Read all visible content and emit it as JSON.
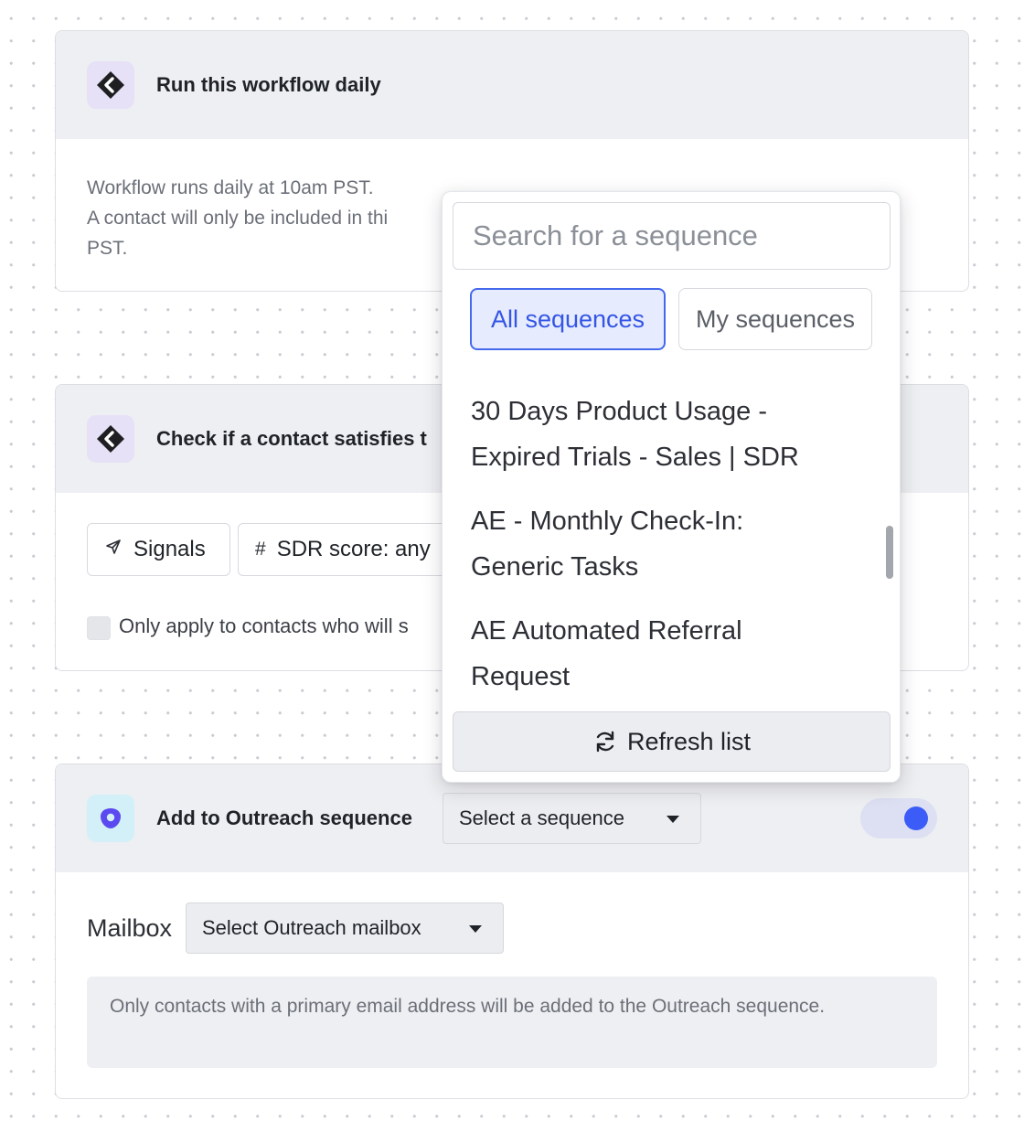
{
  "workflow_step": {
    "title": "Run this workflow daily",
    "description_line1": "Workflow runs daily at 10am PST.",
    "description_line2_visible": "A contact will only be included in thi",
    "description_line3": "PST."
  },
  "condition_step": {
    "title_visible": "Check if a contact satisfies t",
    "signals_label": "Signals",
    "sdr_score_label_visible": "SDR score: any",
    "checkbox_label_visible": "Only apply to contacts who will s",
    "checkbox_checked": false
  },
  "outreach_step": {
    "title": "Add to Outreach sequence",
    "sequence_select_label": "Select a sequence",
    "toggle_on": true,
    "mailbox_label": "Mailbox",
    "mailbox_select_label": "Select Outreach mailbox",
    "note": "Only contacts with a primary email address will be added to the Outreach sequence."
  },
  "sequence_dropdown": {
    "search_placeholder": "Search for a sequence",
    "tabs": [
      {
        "label": "All sequences",
        "active": true
      },
      {
        "label": "My sequences",
        "active": false
      }
    ],
    "items": [
      {
        "line1": "30 Days Product Usage -",
        "line2": "Expired Trials - Sales | SDR"
      },
      {
        "line1": "AE - Monthly Check-In:",
        "line2": "Generic Tasks"
      },
      {
        "line1": "AE Automated Referral",
        "line2": "Request"
      }
    ],
    "refresh_label": "Refresh list"
  },
  "colors": {
    "accent": "#3b5cf6",
    "active_tab_bg": "#e6ecfd",
    "header_bg": "#eeeff2"
  }
}
